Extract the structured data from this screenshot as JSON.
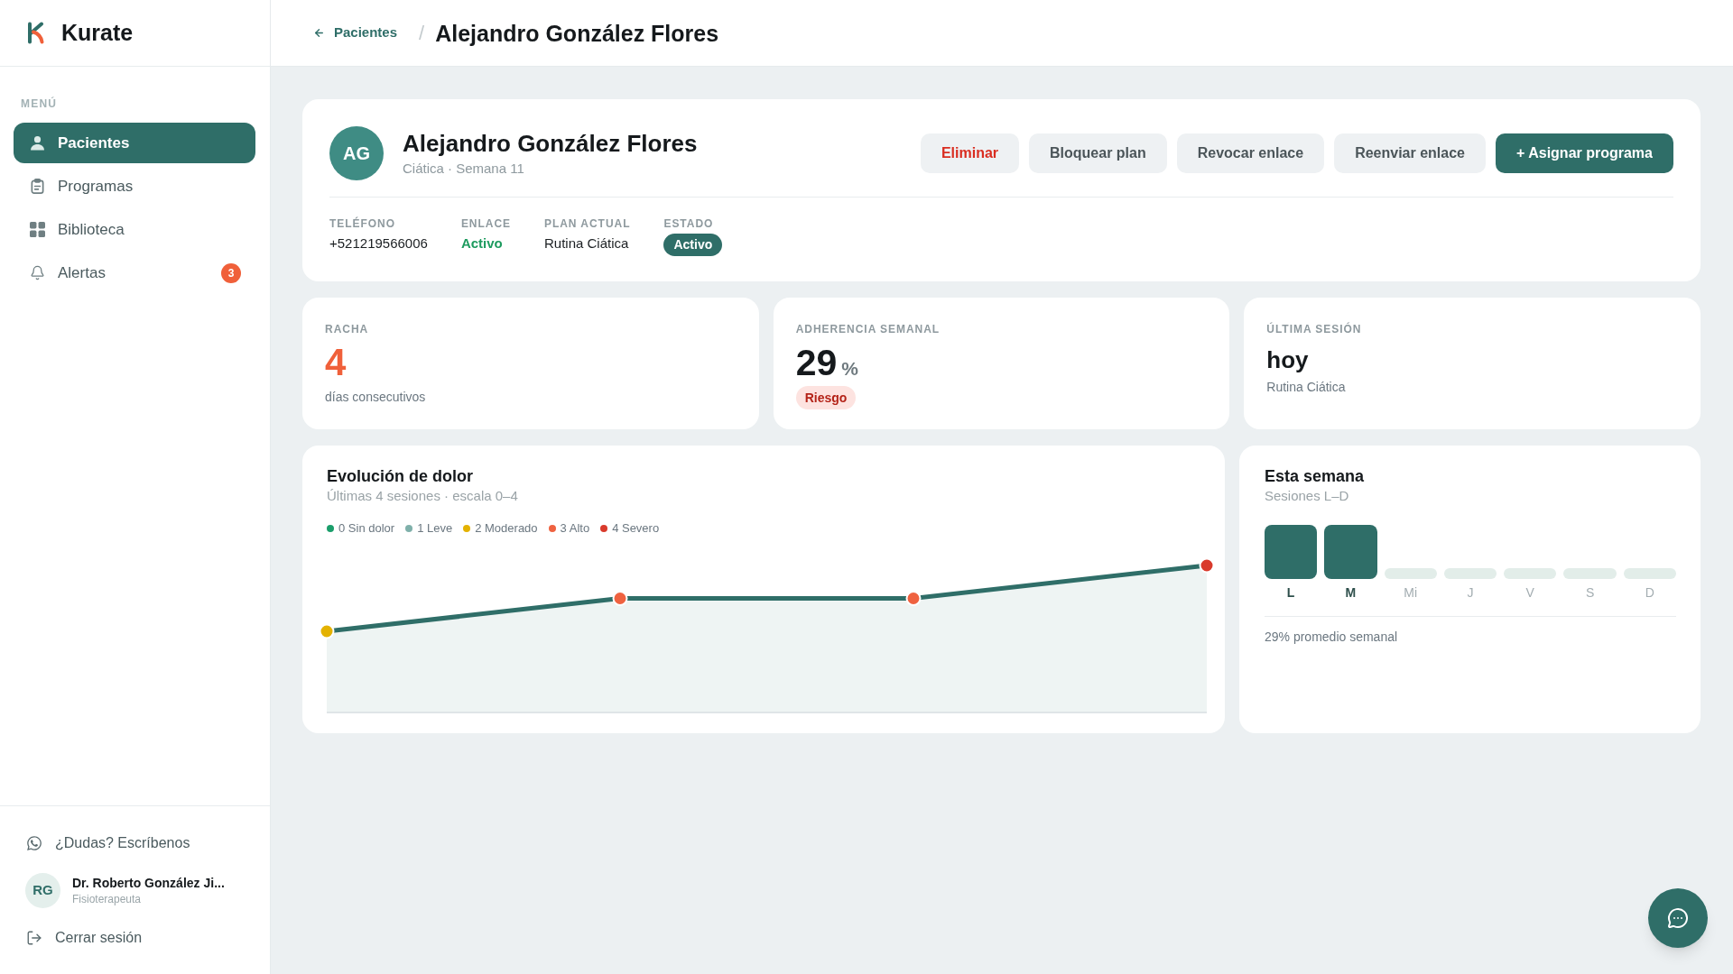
{
  "brand": {
    "name": "Kurate"
  },
  "sidebar": {
    "section_label": "MENÚ",
    "items": [
      {
        "label": "Pacientes",
        "selected": true
      },
      {
        "label": "Programas",
        "selected": false
      },
      {
        "label": "Biblioteca",
        "selected": false
      },
      {
        "label": "Alertas",
        "selected": false,
        "badge": "3"
      }
    ],
    "help_link": "¿Dudas? Escríbenos",
    "user": {
      "initials": "RG",
      "name": "Dr. Roberto González Ji...",
      "role": "Fisioterapeuta"
    },
    "logout": "Cerrar sesión"
  },
  "header": {
    "back_link": "Pacientes",
    "separator": "/",
    "title": "Alejandro González Flores"
  },
  "patient": {
    "initials": "AG",
    "name": "Alejandro González Flores",
    "subtitle": "Ciática · Semana 11",
    "actions": [
      {
        "label": "Eliminar",
        "kind": "danger"
      },
      {
        "label": "Bloquear plan",
        "kind": "secondary"
      },
      {
        "label": "Revocar enlace",
        "kind": "secondary"
      },
      {
        "label": "Reenviar enlace",
        "kind": "secondary"
      },
      {
        "label": "+ Asignar programa",
        "kind": "primary"
      }
    ],
    "fields": [
      {
        "label": "TELÉFONO",
        "value": "+521219566006",
        "kind": "text"
      },
      {
        "label": "ENLACE",
        "value": "Activo",
        "kind": "status"
      },
      {
        "label": "PLAN ACTUAL",
        "value": "Rutina Ciática",
        "kind": "text"
      },
      {
        "label": "ESTADO",
        "value": "Activo",
        "kind": "badge"
      }
    ]
  },
  "stats": [
    {
      "kind": "count",
      "label": "RACHA",
      "value": "4",
      "caption": "días consecutivos"
    },
    {
      "kind": "percent",
      "label": "ADHERENCIA SEMANAL",
      "value": "29",
      "unit": "%",
      "badge": "Riesgo"
    },
    {
      "kind": "text",
      "label": "ÚLTIMA SESIÓN",
      "value": "hoy",
      "caption": "Rutina Ciática"
    }
  ],
  "pain_chart": {
    "title": "Evolución de dolor",
    "subtitle": "Últimas 4 sesiones · escala 0–4",
    "legend": [
      {
        "label": "0 Sin dolor",
        "color": "#1b9e6b"
      },
      {
        "label": "1 Leve",
        "color": "#7fb0aa"
      },
      {
        "label": "2 Moderado",
        "color": "#e4b200"
      },
      {
        "label": "3 Alto",
        "color": "#ef6240"
      },
      {
        "label": "4 Severo",
        "color": "#d93a2c"
      }
    ],
    "sessions": [
      {
        "color": "#e4b200"
      },
      {
        "color": "#ef6240"
      },
      {
        "color": "#ef6240"
      },
      {
        "color": "#d93a2c"
      }
    ]
  },
  "week": {
    "title": "Esta semana",
    "subtitle": "Sesiones L–D",
    "days": [
      {
        "label": "L",
        "done": true
      },
      {
        "label": "M",
        "done": true
      },
      {
        "label": "Mi",
        "done": false
      },
      {
        "label": "J",
        "done": false
      },
      {
        "label": "V",
        "done": false
      },
      {
        "label": "S",
        "done": false
      },
      {
        "label": "D",
        "done": false
      }
    ],
    "summary": "29% promedio semanal"
  }
}
